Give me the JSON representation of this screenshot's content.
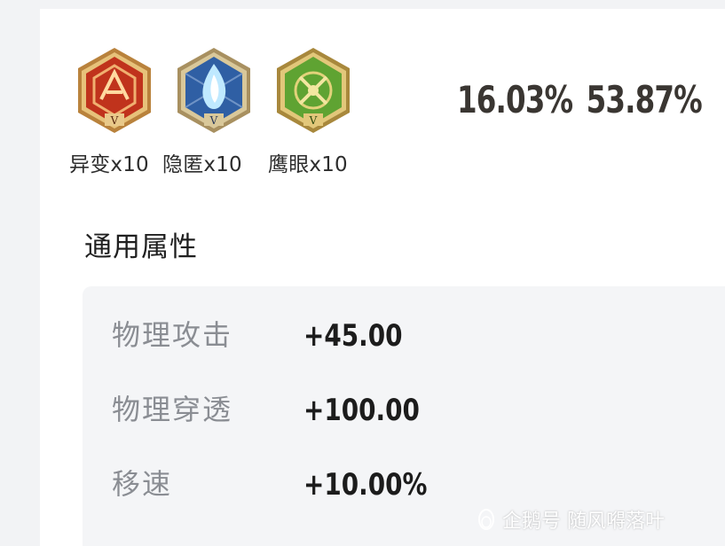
{
  "runes": [
    {
      "name": "异变x10",
      "icon": "red-rune-icon",
      "color": "#c0331c",
      "rim": "#d9a04c"
    },
    {
      "name": "隐匿x10",
      "icon": "blue-rune-icon",
      "color": "#2f5fa4",
      "rim": "#c9b27a"
    },
    {
      "name": "鹰眼x10",
      "icon": "green-rune-icon",
      "color": "#5fa332",
      "rim": "#c9a64c"
    }
  ],
  "rune_numeral": "V",
  "stats": {
    "first": "16.03%",
    "second": "53.87%"
  },
  "section_title": "通用属性",
  "attributes": [
    {
      "name": "物理攻击",
      "value": "+45.00"
    },
    {
      "name": "物理穿透",
      "value": "+100.00"
    },
    {
      "name": "移速",
      "value": "+10.00%"
    }
  ],
  "watermark": "企鹅号 随风嘚落叶"
}
